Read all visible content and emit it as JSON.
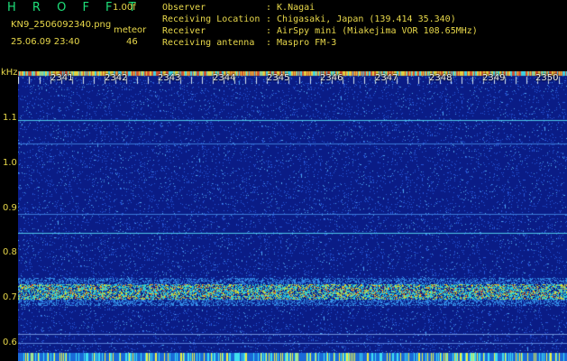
{
  "header": {
    "app_title": "H R O F F T",
    "version": "1.00f",
    "filename": "KN9_2506092340.png",
    "meteor_label": "meteor",
    "datetime": "25.06.09 23:40",
    "meteor_count": "46"
  },
  "info": [
    {
      "key": "Observer",
      "value": ": K.Nagai"
    },
    {
      "key": "Receiving Location",
      "value": ": Chigasaki, Japan (139.414 35.340)"
    },
    {
      "key": "Receiver",
      "value": ": AirSpy mini (Miakejima VOR 108.65MHz)"
    },
    {
      "key": "Receiving antenna",
      "value": ": Maspro FM-3"
    }
  ],
  "axis": {
    "unit": "kHz",
    "freq_labels": [
      "1.1",
      "1.0",
      "0.9",
      "0.8",
      "0.7",
      "0.6"
    ],
    "time_labels": [
      "2341",
      "2342",
      "2343",
      "2344",
      "2345",
      "2346",
      "2347",
      "2348",
      "2349",
      "2350"
    ]
  },
  "colors": {
    "label_yellow": "#e8d84a",
    "title_green": "#1ee07a",
    "background_blue": "#0b1f8c"
  }
}
